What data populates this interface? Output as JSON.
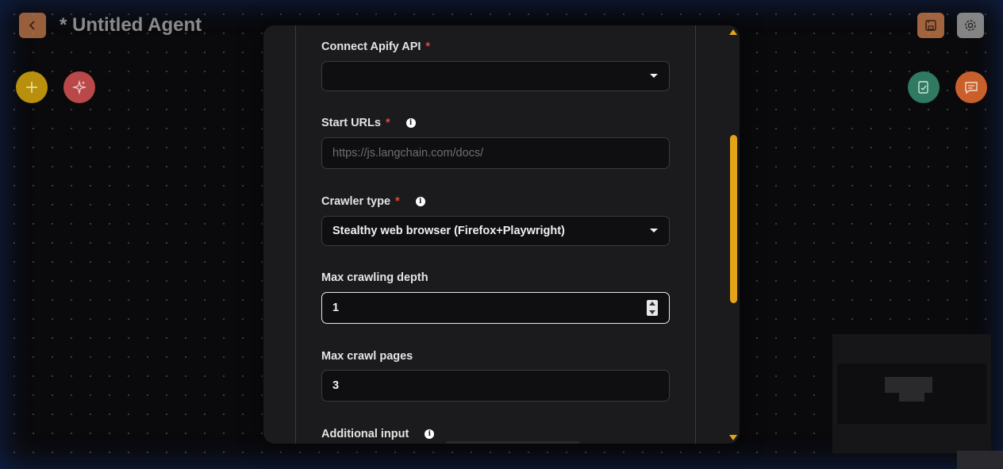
{
  "header": {
    "title": "* Untitled Agent"
  },
  "icons": {
    "back": "chevron-left-icon",
    "save": "save-icon",
    "settings": "gear-icon",
    "add": "plus-icon",
    "magic": "sparkles-icon",
    "notes": "checklist-icon",
    "chat": "chat-icon"
  },
  "colors": {
    "accent": "#e3a417",
    "required": "#e04a3a",
    "dialog_bg": "#1b1b1d",
    "field_bg": "#0f0f11"
  },
  "form": {
    "apify": {
      "label": "Connect Apify API",
      "required_mark": "*",
      "value": ""
    },
    "start_urls": {
      "label": "Start URLs",
      "required_mark": "*",
      "placeholder": "https://js.langchain.com/docs/"
    },
    "crawler_type": {
      "label": "Crawler type",
      "required_mark": "*",
      "value": "Stealthy web browser (Firefox+Playwright)"
    },
    "max_depth": {
      "label": "Max crawling depth",
      "value": "1"
    },
    "max_pages": {
      "label": "Max crawl pages",
      "value": "3"
    },
    "additional_input": {
      "label": "Additional input"
    }
  }
}
